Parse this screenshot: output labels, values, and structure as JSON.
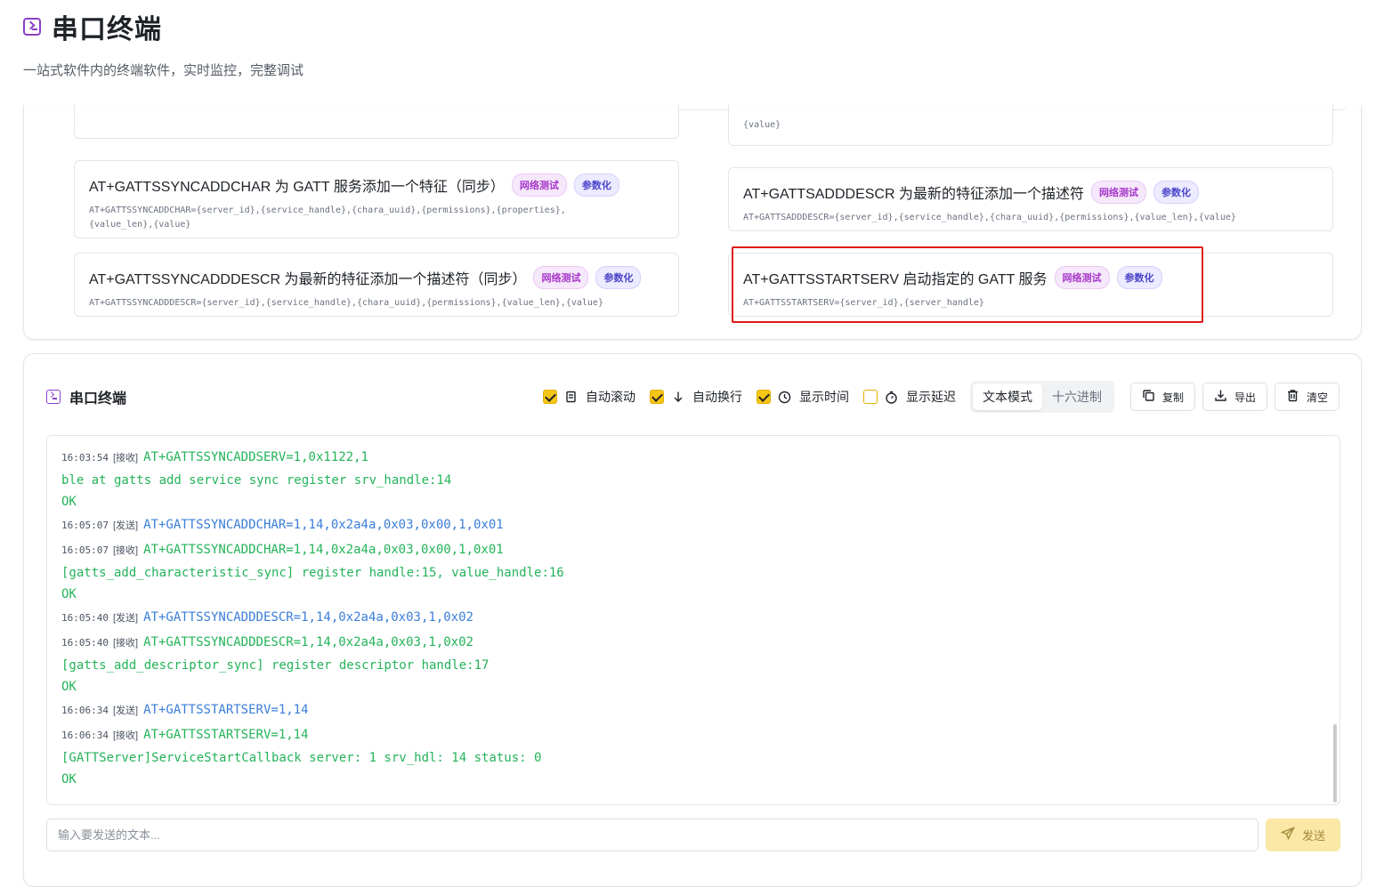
{
  "header": {
    "title": "串口终端",
    "subtitle": "一站式软件内的终端软件，实时监控，完整调试"
  },
  "partial_top": {
    "right_syntax": "{value}"
  },
  "commands": [
    {
      "title": "AT+GATTSSYNCADDCHAR 为 GATT 服务添加一个特征（同步）",
      "tags": [
        "网络测试",
        "参数化"
      ],
      "syntax_line1": "AT+GATTSSYNCADDCHAR={server_id},{service_handle},{chara_uuid},{permissions},{properties},",
      "syntax_line2": "{value_len},{value}"
    },
    {
      "title": "AT+GATTSADDDESCR 为最新的特征添加一个描述符",
      "tags": [
        "网络测试",
        "参数化"
      ],
      "syntax_line1": "AT+GATTSADDDESCR={server_id},{service_handle},{chara_uuid},{permissions},{value_len},{value}"
    },
    {
      "title": "AT+GATTSSYNCADDDESCR 为最新的特征添加一个描述符（同步）",
      "tags": [
        "网络测试",
        "参数化"
      ],
      "syntax_line1": "AT+GATTSSYNCADDDESCR={server_id},{service_handle},{chara_uuid},{permissions},{value_len},{value}"
    },
    {
      "title": "AT+GATTSSTARTSERV 启动指定的 GATT 服务",
      "tags": [
        "网络测试",
        "参数化"
      ],
      "syntax_line1": "AT+GATTSSTARTSERV={server_id},{server_handle}"
    }
  ],
  "terminal": {
    "title": "串口终端",
    "options": {
      "auto_scroll": {
        "label": "自动滚动",
        "checked": true
      },
      "auto_wrap": {
        "label": "自动换行",
        "checked": true
      },
      "show_time": {
        "label": "显示时间",
        "checked": true
      },
      "show_delay": {
        "label": "显示延迟",
        "checked": false
      }
    },
    "mode_text": "文本模式",
    "mode_hex": "十六进制",
    "active_mode": "文本模式",
    "copy_label": "复制",
    "export_label": "导出",
    "clear_label": "清空",
    "logs": [
      {
        "time": "16:03:54",
        "dir": "[接收]",
        "type": "recv",
        "text": "AT+GATTSSYNCADDSERV=1,0x1122,1"
      },
      {
        "time": "",
        "dir": "",
        "type": "recv",
        "text": "ble at gatts add service sync register srv_handle:14"
      },
      {
        "time": "",
        "dir": "",
        "type": "recv",
        "text": "OK"
      },
      {
        "time": "16:05:07",
        "dir": "[发送]",
        "type": "send",
        "text": "AT+GATTSSYNCADDCHAR=1,14,0x2a4a,0x03,0x00,1,0x01"
      },
      {
        "time": "16:05:07",
        "dir": "[接收]",
        "type": "recv",
        "text": "AT+GATTSSYNCADDCHAR=1,14,0x2a4a,0x03,0x00,1,0x01"
      },
      {
        "time": "",
        "dir": "",
        "type": "recv",
        "text": "[gatts_add_characteristic_sync] register handle:15, value_handle:16"
      },
      {
        "time": "",
        "dir": "",
        "type": "recv",
        "text": "OK"
      },
      {
        "time": "16:05:40",
        "dir": "[发送]",
        "type": "send",
        "text": "AT+GATTSSYNCADDDESCR=1,14,0x2a4a,0x03,1,0x02"
      },
      {
        "time": "16:05:40",
        "dir": "[接收]",
        "type": "recv",
        "text": "AT+GATTSSYNCADDDESCR=1,14,0x2a4a,0x03,1,0x02"
      },
      {
        "time": "",
        "dir": "",
        "type": "recv",
        "text": "[gatts_add_descriptor_sync] register descriptor handle:17"
      },
      {
        "time": "",
        "dir": "",
        "type": "recv",
        "text": "OK"
      },
      {
        "time": "16:06:34",
        "dir": "[发送]",
        "type": "send",
        "text": "AT+GATTSSTARTSERV=1,14"
      },
      {
        "time": "16:06:34",
        "dir": "[接收]",
        "type": "recv",
        "text": "AT+GATTSSTARTSERV=1,14"
      },
      {
        "time": "",
        "dir": "",
        "type": "recv",
        "text": "[GATTServer]ServiceStartCallback server: 1 srv_hdl: 14 status: 0"
      },
      {
        "time": "",
        "dir": "",
        "type": "recv",
        "text": "OK"
      }
    ],
    "input_placeholder": "输入要发送的文本...",
    "send_label": "发送"
  },
  "colors": {
    "accent": "#8b3fc7",
    "send_text": "#3b7ed8",
    "recv_text": "#24b35a",
    "checkbox": "#f5c518",
    "highlight": "#e0191b",
    "send_button_bg": "#fbe8a6"
  },
  "icons": {
    "title": "terminal-icon",
    "auto_scroll": "scroll-text-icon",
    "auto_wrap": "arrow-down-icon",
    "show_time": "clock-icon",
    "show_delay": "timer-icon",
    "copy": "copy-icon",
    "export": "download-icon",
    "clear": "trash-icon",
    "send": "send-icon"
  }
}
